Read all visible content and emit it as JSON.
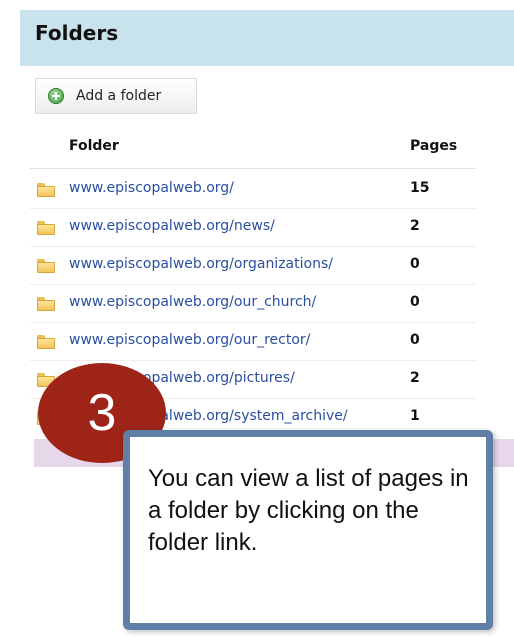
{
  "panel": {
    "title": "Folders"
  },
  "toolbar": {
    "add_label": "Add a folder"
  },
  "table": {
    "headers": {
      "folder": "Folder",
      "pages": "Pages"
    },
    "rows": [
      {
        "folder": "www.episcopalweb.org/",
        "pages": "15"
      },
      {
        "folder": "www.episcopalweb.org/news/",
        "pages": "2"
      },
      {
        "folder": "www.episcopalweb.org/organizations/",
        "pages": "0"
      },
      {
        "folder": "www.episcopalweb.org/our_church/",
        "pages": "0"
      },
      {
        "folder": "www.episcopalweb.org/our_rector/",
        "pages": "0"
      },
      {
        "folder": "www.episcopalweb.org/pictures/",
        "pages": "2"
      },
      {
        "folder": "www.episcopalweb.org/system_archive/",
        "pages": "1"
      }
    ]
  },
  "step": {
    "number": "3"
  },
  "callout": {
    "text": "You can view a list of pages in a folder by clicking on the folder link."
  },
  "icons": {
    "add": "plus-circle-icon",
    "folder": "folder-icon"
  },
  "colors": {
    "header_bg": "#c9e3ec",
    "link": "#2b4fa0",
    "badge": "#9e2418",
    "callout_border": "#5f7fa7"
  }
}
